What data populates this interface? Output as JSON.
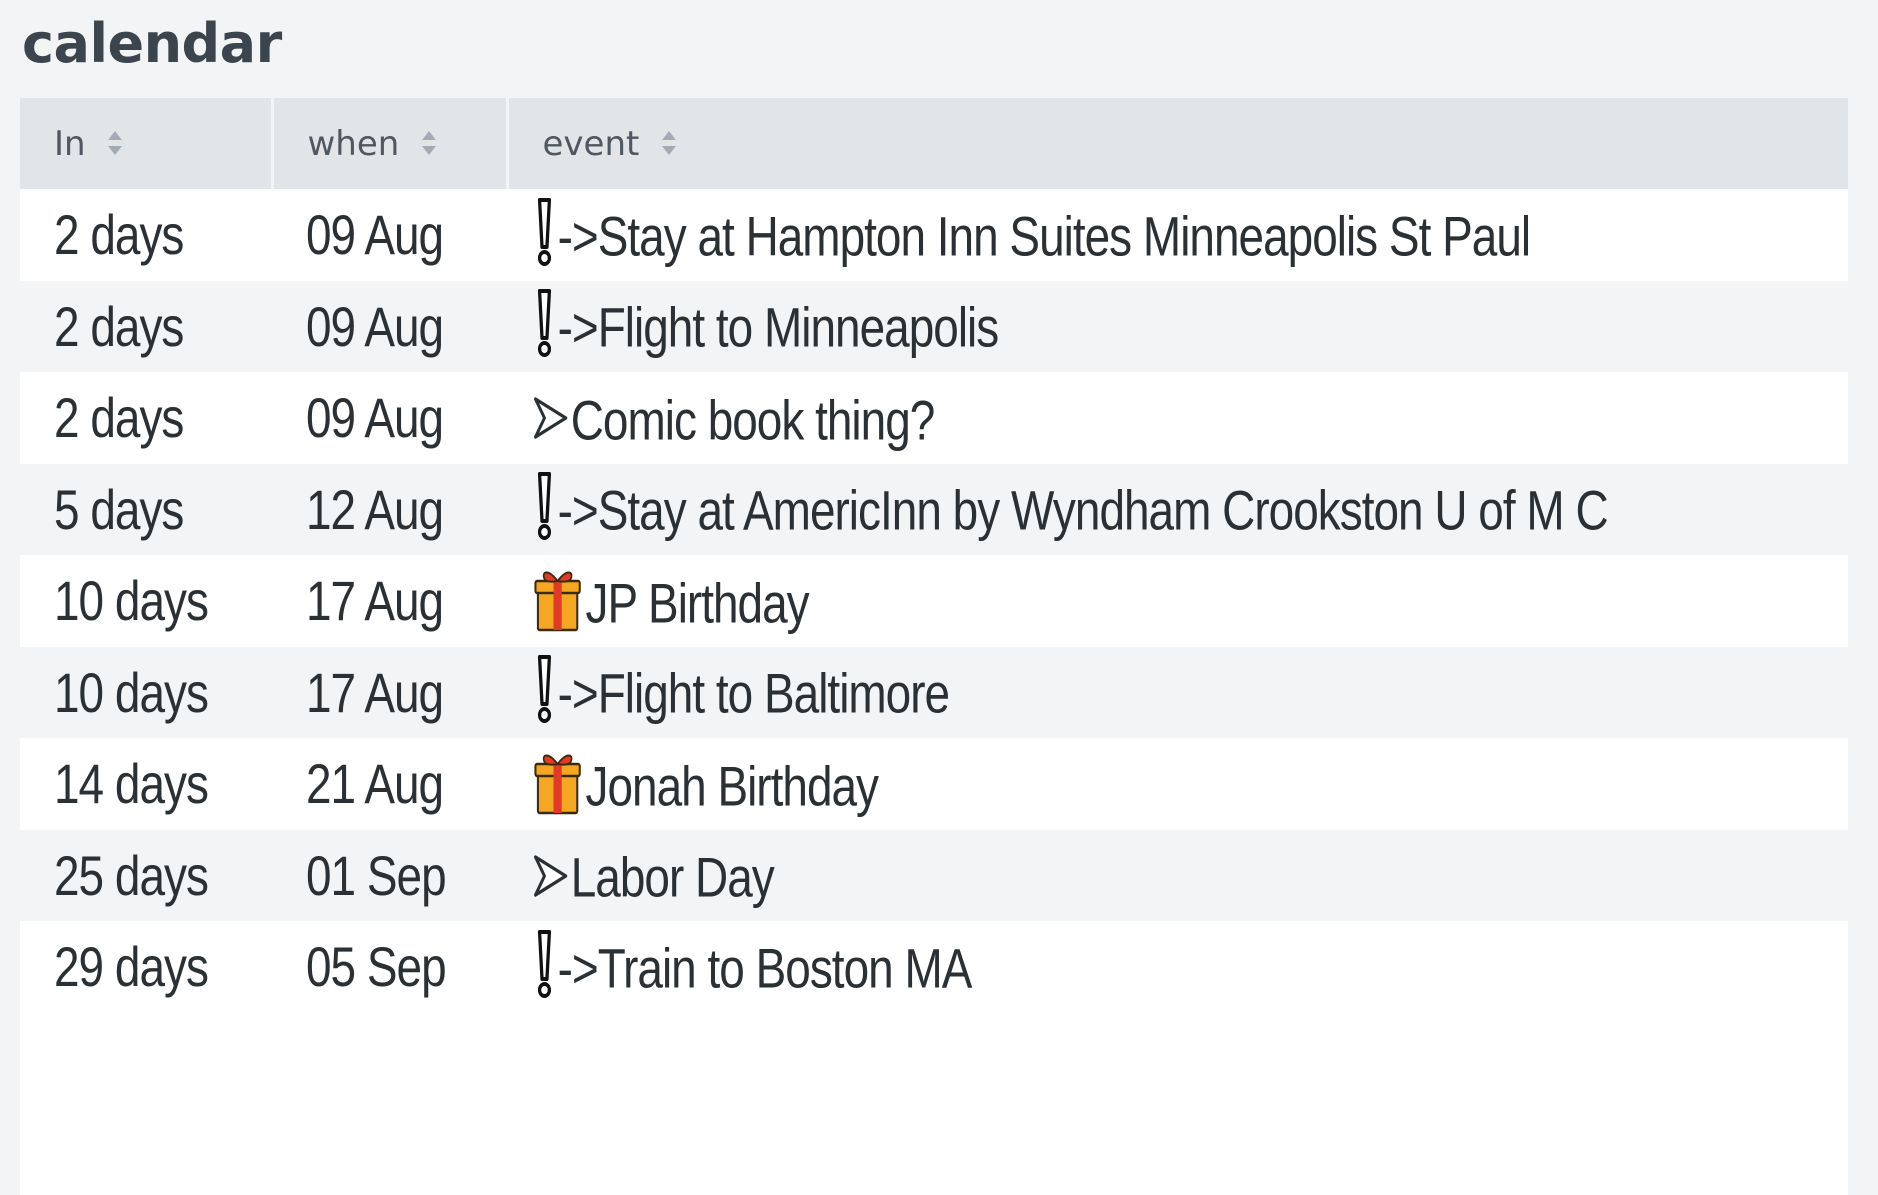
{
  "panel": {
    "title": "calendar"
  },
  "table": {
    "columns": [
      {
        "key": "in",
        "label": "In"
      },
      {
        "key": "when",
        "label": "when"
      },
      {
        "key": "event",
        "label": "event"
      }
    ],
    "rows": [
      {
        "in": "2 days",
        "when": "09 Aug",
        "icon": "exclamation-icon",
        "prefix": "->",
        "text": "Stay at Hampton Inn Suites Minneapolis St Paul"
      },
      {
        "in": "2 days",
        "when": "09 Aug",
        "icon": "exclamation-icon",
        "prefix": "->",
        "text": "Flight to Minneapolis"
      },
      {
        "in": "2 days",
        "when": "09 Aug",
        "icon": "arrow-icon",
        "prefix": "",
        "text": "Comic book thing?"
      },
      {
        "in": "5 days",
        "when": "12 Aug",
        "icon": "exclamation-icon",
        "prefix": "->",
        "text": "Stay at AmericInn by Wyndham Crookston U of M C"
      },
      {
        "in": "10 days",
        "when": "17 Aug",
        "icon": "gift-icon",
        "prefix": "",
        "text": "JP Birthday"
      },
      {
        "in": "10 days",
        "when": "17 Aug",
        "icon": "exclamation-icon",
        "prefix": "->",
        "text": "Flight to Baltimore"
      },
      {
        "in": "14 days",
        "when": "21 Aug",
        "icon": "gift-icon",
        "prefix": "",
        "text": "Jonah Birthday"
      },
      {
        "in": "25 days",
        "when": "01 Sep",
        "icon": "arrow-icon",
        "prefix": "",
        "text": "Labor Day"
      },
      {
        "in": "29 days",
        "when": "05 Sep",
        "icon": "exclamation-icon",
        "prefix": "->",
        "text": "Train to Boston MA"
      }
    ]
  },
  "colors": {
    "background": "#f3f4f5",
    "header_bg": "#e1e5e8",
    "text": "#2b3034",
    "gift_body": "#f5a623",
    "gift_ribbon": "#e03b24"
  }
}
